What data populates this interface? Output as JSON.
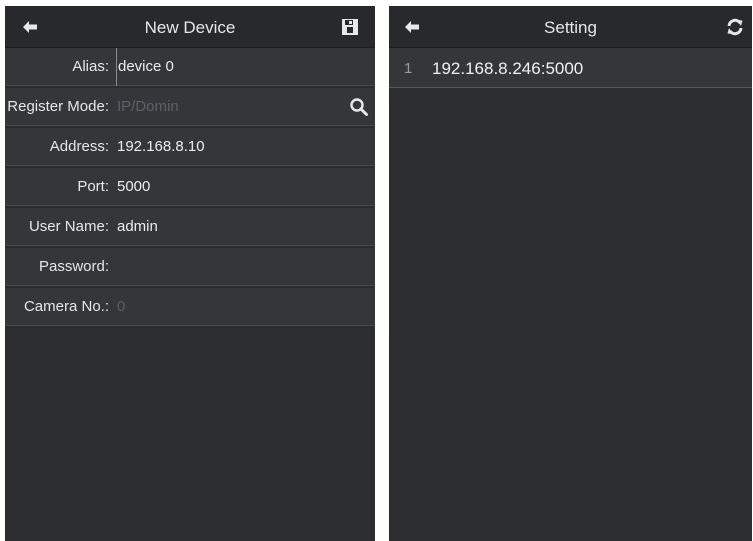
{
  "new_device": {
    "title": "New Device",
    "back_icon": "back-arrow-icon",
    "save_icon": "save-icon",
    "fields": [
      {
        "label": "Alias:",
        "value": "device 0",
        "placeholder": false
      },
      {
        "label": "Register Mode:",
        "value": "IP/Domin",
        "placeholder": true
      },
      {
        "label": "Address:",
        "value": "192.168.8.10",
        "placeholder": false
      },
      {
        "label": "Port:",
        "value": "5000",
        "placeholder": false
      },
      {
        "label": "User Name:",
        "value": "admin",
        "placeholder": false
      },
      {
        "label": "Password:",
        "value": "",
        "placeholder": false
      },
      {
        "label": "Camera No.:",
        "value": "0",
        "placeholder": true
      }
    ],
    "search_icon": "search-icon"
  },
  "setting": {
    "title": "Setting",
    "back_icon": "back-arrow-icon",
    "refresh_icon": "refresh-icon",
    "items": [
      {
        "index": "1",
        "address": "192.168.8.246:5000"
      }
    ]
  },
  "colors": {
    "panel_bg": "#2b2d30",
    "row_bg": "#34373a",
    "text": "#e6e6e6",
    "placeholder": "#5c6064"
  }
}
